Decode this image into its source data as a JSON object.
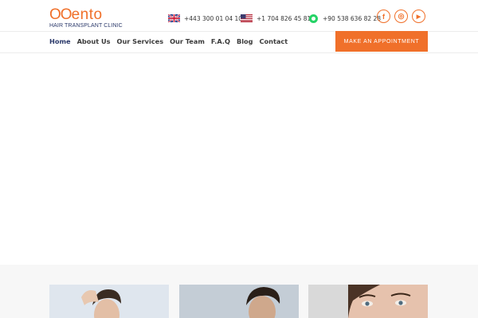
{
  "logo": {
    "word_oo": "OO",
    "word_rest": "ento",
    "tagline": "HAIR TRANSPLANT CLINIC"
  },
  "contacts": [
    {
      "flag_icon": "uk-flag-icon",
      "phone": "+443 300 01 04 10"
    },
    {
      "flag_icon": "us-flag-icon",
      "phone": "+1 704 826 45 81"
    },
    {
      "flag_icon": "whatsapp-icon",
      "phone": "+90 538 636 82 28"
    }
  ],
  "social": [
    {
      "icon": "facebook-icon",
      "glyph": "f"
    },
    {
      "icon": "instagram-icon",
      "glyph": "◎"
    },
    {
      "icon": "youtube-icon",
      "glyph": "▶"
    }
  ],
  "nav": {
    "items": [
      "Home",
      "About Us",
      "Our Services",
      "Our Team",
      "F.A.Q",
      "Blog",
      "Contact"
    ],
    "active": "Home",
    "cta": "MAKE AN APPOINTMENT"
  },
  "colors": {
    "accent": "#f0702a",
    "brand_navy": "#2c3a6b"
  },
  "cards": [
    {
      "image": "man-touching-hair-photo"
    },
    {
      "image": "man-side-profile-photo"
    },
    {
      "image": "woman-eyes-eyebrows-photo"
    }
  ]
}
